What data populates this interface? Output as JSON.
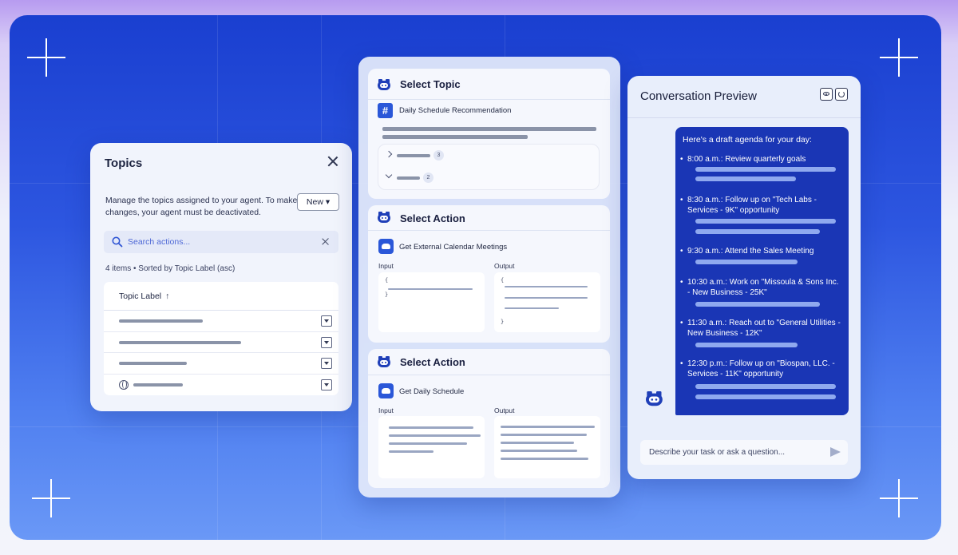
{
  "topics": {
    "title": "Topics",
    "description": "Manage the topics assigned to your agent. To make changes, your agent must be deactivated.",
    "new_label": "New ▾",
    "search_placeholder": "Search actions...",
    "items_meta": "4 items • Sorted by Topic Label (asc)",
    "column_header": "Topic Label",
    "sort_arrow": "↑"
  },
  "select_topic": {
    "title": "Select Topic",
    "topic_name": "Daily Schedule Recommendation",
    "badge_icon": "#",
    "expanders": [
      {
        "count": "3"
      },
      {
        "count": "2"
      }
    ]
  },
  "action_1": {
    "title": "Select Action",
    "name": "Get External Calendar Meetings",
    "input_label": "Input",
    "output_label": "Output"
  },
  "action_2": {
    "title": "Select Action",
    "name": "Get Daily Schedule",
    "input_label": "Input",
    "output_label": "Output"
  },
  "conversation": {
    "title": "Conversation Preview",
    "intro": "Here's a draft agenda for your day:",
    "agenda": [
      "8:00 a.m.: Review quarterly goals",
      "8:30 a.m.: Follow up on \"Tech Labs - Services - 9K\" opportunity",
      "9:30 a.m.: Attend the Sales Meeting",
      "10:30 a.m.: Work on \"Missoula & Sons Inc. - New Business - 25K\"",
      "11:30 a.m.: Reach out to \"General Utilities - New Business - 12K\"",
      "12:30 p.m.: Follow up on \"Biospan, LLC. - Services - 11K\" opportunity"
    ],
    "input_placeholder": "Describe your task or ask a question..."
  },
  "icons": {
    "search": "search-icon",
    "close": "close-icon",
    "agent": "agent-icon",
    "eye": "eye-icon",
    "refresh": "refresh-icon",
    "send": "send-icon",
    "globe": "globe-icon"
  },
  "colors": {
    "accent": "#1a36b5",
    "brand_blue": "#2a57d8",
    "stage_top": "#1a3fd0",
    "stage_bottom": "#6a98f6"
  }
}
